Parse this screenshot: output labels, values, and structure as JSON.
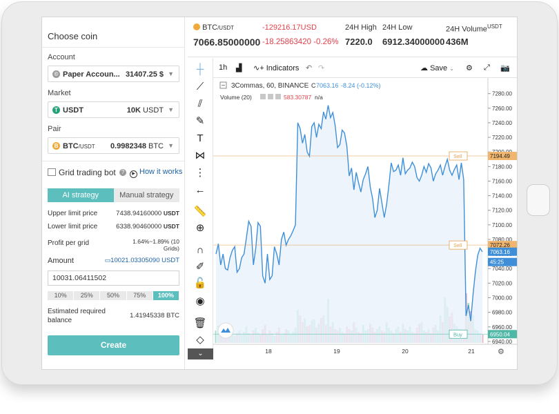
{
  "left_panel": {
    "title": "Choose coin",
    "account_label": "Account",
    "account_name": "Paper Accoun...",
    "account_value": "31407.25 $",
    "market_label": "Market",
    "market_name": "USDT",
    "market_value_num": "10K",
    "market_value_unit": "USDT",
    "pair_label": "Pair",
    "pair_name": "BTC",
    "pair_quote": "/USDT",
    "pair_value_num": "0.9982348",
    "pair_value_unit": "BTC",
    "bot_title": "Grid trading bot",
    "how_it_works": "How it works",
    "tab_ai": "AI strategy",
    "tab_manual": "Manual strategy",
    "upper_label": "Upper limit price",
    "upper_value": "7438.94160000",
    "upper_unit": "USDT",
    "lower_label": "Lower limit price",
    "lower_value": "6338.90460000",
    "lower_unit": "USDT",
    "profit_label": "Profit per grid",
    "profit_value_1": "1.64%~1.89% (10",
    "profit_value_2": "Grids)",
    "amount_label": "Amount",
    "amount_link": "10021.03305090 USDT",
    "amount_input": "10031.06411502",
    "percent_buttons": [
      "10%",
      "25%",
      "50%",
      "75%",
      "100%"
    ],
    "estimated_label_1": "Estimated required",
    "estimated_label_2": "balance",
    "estimated_value": "1.41945338 BTC",
    "create_button": "Create"
  },
  "ticker": {
    "pair": "BTC",
    "pair_quote": "/USDT",
    "price": "7066.85000000",
    "change_abs": "-129216.17USD",
    "change_line2": "-18.25863420 -0.26%",
    "high_label": "24H High",
    "high_value": "7220.0",
    "low_label": "24H Low",
    "low_value": "6912.34000000",
    "volume_label": "24H Volume",
    "volume_unit": "USDT",
    "volume_value": "436M"
  },
  "toolbar": {
    "interval": "1h",
    "indicators": "Indicators",
    "save": "Save"
  },
  "legend": {
    "symbol": "3Commas, 60, BINANCE",
    "price_prefix": "C",
    "price": "7063.16",
    "change": "-8.24 (-0.12%)",
    "volume_label": "Volume (20)",
    "volume_value": "583.30787",
    "volume_na": "n/a"
  },
  "colors": {
    "accent": "#5dbfbd",
    "line": "#3f8fd8",
    "sell": "#e8a050",
    "buy": "#4fb7a6",
    "down": "#e0424b"
  },
  "chart_data": {
    "type": "line",
    "x_ticks": [
      "18",
      "19",
      "20",
      "21"
    ],
    "y_ticks": [
      6940,
      6960,
      6980,
      7000,
      7020,
      7040,
      7060,
      7080,
      7100,
      7120,
      7140,
      7160,
      7180,
      7200,
      7220,
      7240,
      7260,
      7280
    ],
    "ylim": [
      6938,
      7292
    ],
    "price_labels": [
      {
        "label": "7194.49",
        "value": 7194.49,
        "kind": "sell"
      },
      {
        "label": "7072.26",
        "value": 7072.26,
        "kind": "sell"
      },
      {
        "label": "7063.16",
        "value": 7063.16,
        "kind": "current"
      },
      {
        "label": "45:25",
        "value": 7049,
        "kind": "timer"
      },
      {
        "label": "6950.04",
        "value": 6950.04,
        "kind": "buy"
      }
    ],
    "order_lines": [
      {
        "label": "Sell",
        "value": 7194.49
      },
      {
        "label": "Sell",
        "value": 7072.26
      },
      {
        "label": "Buy",
        "value": 6950.04
      }
    ],
    "price": [
      7060,
      7074,
      7045,
      7060,
      7040,
      7038,
      7055,
      7065,
      7070,
      7035,
      7040,
      7055,
      7060,
      7082,
      7105,
      7098,
      7045,
      7068,
      7103,
      7098,
      7030,
      7020,
      7060,
      7025,
      7030,
      7070,
      7060,
      7045,
      7080,
      7090,
      7072,
      7080,
      7085,
      7092,
      7100,
      7240,
      7232,
      7212,
      7224,
      7200,
      7194,
      7235,
      7240,
      7220,
      7238,
      7232,
      7255,
      7245,
      7264,
      7247,
      7254,
      7236,
      7206,
      7210,
      7230,
      7226,
      7208,
      7167,
      7178,
      7148,
      7172,
      7158,
      7145,
      7162,
      7170,
      7180,
      7152,
      7136,
      7110,
      7120,
      7150,
      7130,
      7110,
      7128,
      7155,
      7185,
      7173,
      7175,
      7182,
      7168,
      7192,
      7170,
      7175,
      7178,
      7186,
      7180,
      7165,
      7160,
      7168,
      7180,
      7172,
      7184,
      7178,
      7160,
      7170,
      7175,
      7182,
      7168,
      7180,
      7190,
      7175,
      7168,
      7176,
      7182,
      7162,
      7185,
      7162,
      6975,
      6990,
      6968,
      7005,
      7035,
      7058,
      7068,
      7063
    ],
    "volume": [
      18,
      25,
      14,
      20,
      16,
      12,
      15,
      22,
      10,
      14,
      18,
      12,
      16,
      24,
      14,
      12,
      18,
      22,
      15,
      12,
      20,
      26,
      12,
      18,
      14,
      10,
      16,
      22,
      12,
      14,
      20,
      18,
      12,
      16,
      22,
      48,
      40,
      30,
      36,
      24,
      26,
      32,
      34,
      22,
      28,
      36,
      40,
      26,
      64,
      24,
      30,
      20,
      18,
      22,
      16,
      14,
      24,
      20,
      18,
      30,
      22,
      16,
      14,
      26,
      18,
      20,
      28,
      22,
      16,
      20,
      24,
      18,
      16,
      30,
      22,
      18,
      14,
      20,
      24,
      16,
      28,
      20,
      18,
      24,
      16,
      14,
      22,
      28,
      30,
      18,
      16,
      20,
      14,
      22,
      26,
      18,
      40,
      30,
      66,
      52,
      38,
      44,
      28,
      24,
      20,
      18,
      14,
      72,
      58,
      46,
      40,
      20,
      18,
      14,
      12
    ]
  }
}
